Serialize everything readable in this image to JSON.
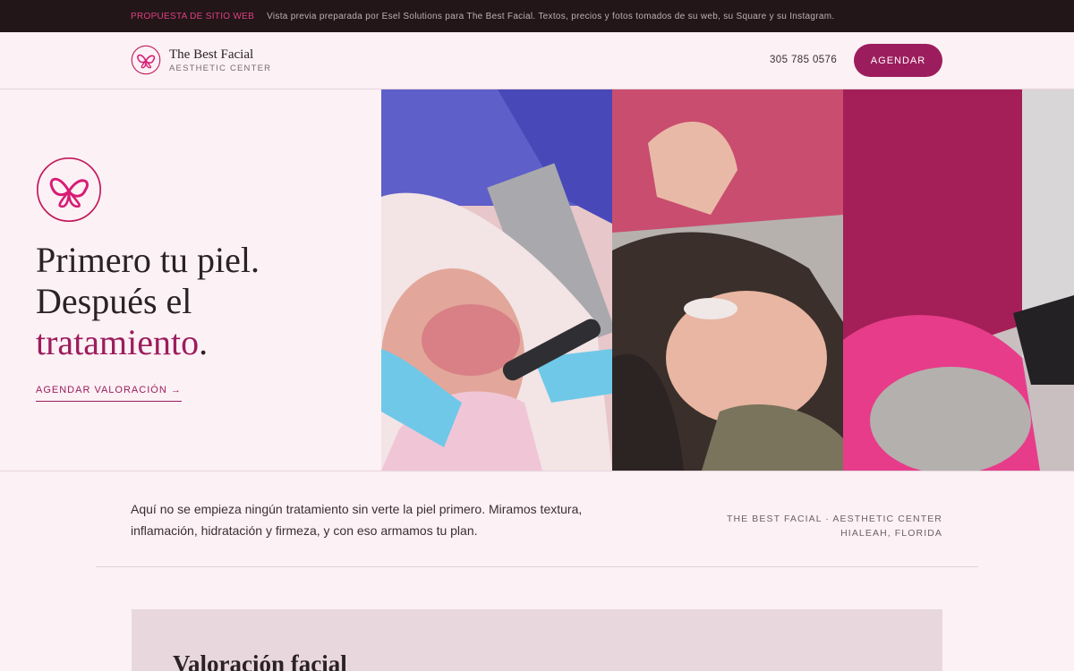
{
  "banner": {
    "tag": "PROPUESTA DE SITIO WEB",
    "message": "Vista previa preparada por Esel Solutions para The Best Facial. Textos, precios y fotos tomados de su web, su Square y su Instagram."
  },
  "header": {
    "brand_name": "The Best Facial",
    "brand_sub": "AESTHETIC CENTER",
    "phone": "305 785 0576",
    "cta_label": "AGENDAR"
  },
  "hero": {
    "headline_line1": "Primero tu piel.",
    "headline_line2": "Después el",
    "headline_accent": "tratamiento",
    "headline_end": ".",
    "link_label": "AGENDAR VALORACIÓN →"
  },
  "intro": {
    "text": "Aquí no se empieza ningún tratamiento sin verte la piel primero. Miramos textura, inflamación, hidratación y firmeza, y con eso armamos tu plan.",
    "place_line1": "THE BEST FACIAL · AESTHETIC CENTER",
    "place_line2": "HIALEAH, FLORIDA"
  },
  "section": {
    "title": "Valoración facial"
  },
  "colors": {
    "accent": "#9c1d5d",
    "banner_bg": "#221619",
    "page_bg": "#fcf1f5",
    "card_bg": "#e8d8dd"
  },
  "icons": {
    "brand_mark": "butterfly-logo-icon"
  }
}
